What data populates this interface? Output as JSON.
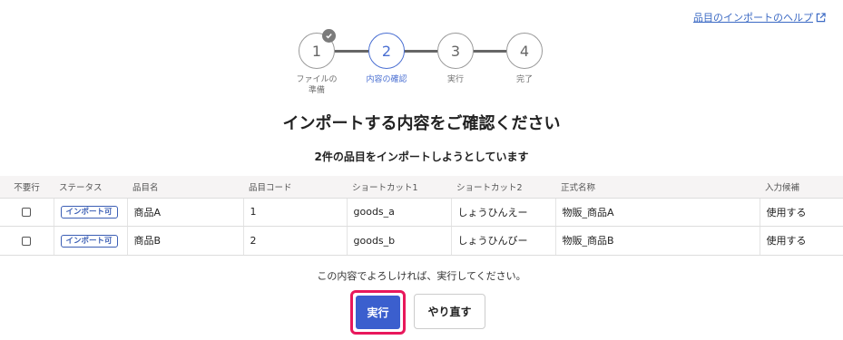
{
  "help_link": {
    "label": "品目のインポートのヘルプ",
    "icon": "external-link-icon"
  },
  "stepper": {
    "steps": [
      {
        "number": "1",
        "label": "ファイルの\n準備",
        "state": "done"
      },
      {
        "number": "2",
        "label": "内容の確認",
        "state": "active"
      },
      {
        "number": "3",
        "label": "実行",
        "state": "pending"
      },
      {
        "number": "4",
        "label": "完了",
        "state": "pending"
      }
    ]
  },
  "title": "インポートする内容をご確認ください",
  "subtitle": "2件の品目をインポートしようとしています",
  "table": {
    "headers": [
      "不要行",
      "ステータス",
      "品目名",
      "品目コード",
      "ショートカット1",
      "ショートカット2",
      "正式名称",
      "入力候補"
    ],
    "rows": [
      {
        "unneeded": false,
        "status": "インポート可",
        "name": "商品A",
        "code": "1",
        "shortcut1": "goods_a",
        "shortcut2": "しょうひんえー",
        "formal_name": "物販_商品A",
        "candidate": "使用する"
      },
      {
        "unneeded": false,
        "status": "インポート可",
        "name": "商品B",
        "code": "2",
        "shortcut1": "goods_b",
        "shortcut2": "しょうひんびー",
        "formal_name": "物販_商品B",
        "candidate": "使用する"
      }
    ]
  },
  "confirm_text": "この内容でよろしければ、実行してください。",
  "buttons": {
    "execute": "実行",
    "redo": "やり直す"
  },
  "colors": {
    "accent": "#3b5fce",
    "highlight": "#e8185c",
    "link": "#3c6ac4"
  }
}
